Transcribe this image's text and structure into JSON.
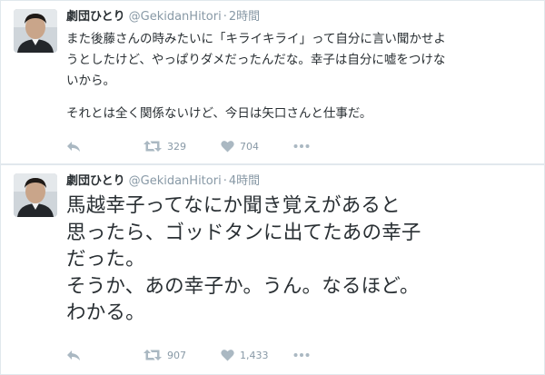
{
  "tweets": [
    {
      "name": "劇団ひとり",
      "handle": "@GekidanHitori",
      "time": "2時間",
      "lines": [
        "また後藤さんの時みたいに「キライキライ」って自分に言い聞かせよ",
        "うとしたけど、やっぱりダメだったんだな。幸子は自分に嘘をつけな",
        "いから。"
      ],
      "paragraph2": "それとは全く関係ないけど、今日は矢口さんと仕事だ。",
      "retweets": "329",
      "likes": "704"
    },
    {
      "name": "劇団ひとり",
      "handle": "@GekidanHitori",
      "time": "4時間",
      "lines": [
        "馬越幸子ってなにか聞き覚えがあると",
        "思ったら、ゴッドタンに出てたあの幸子",
        "だった。",
        "そうか、あの幸子か。うん。なるほど。",
        "わかる。"
      ],
      "retweets": "907",
      "likes": "1,433"
    }
  ],
  "separator": "·",
  "icons": {
    "reply": "reply-arrow-icon",
    "retweet": "retweet-icon",
    "like": "heart-icon",
    "more": "more-dots-icon"
  },
  "colors": {
    "text": "#292f33",
    "meta": "#8899a6",
    "icon": "#aab8c2",
    "border": "#e1e8ed"
  }
}
